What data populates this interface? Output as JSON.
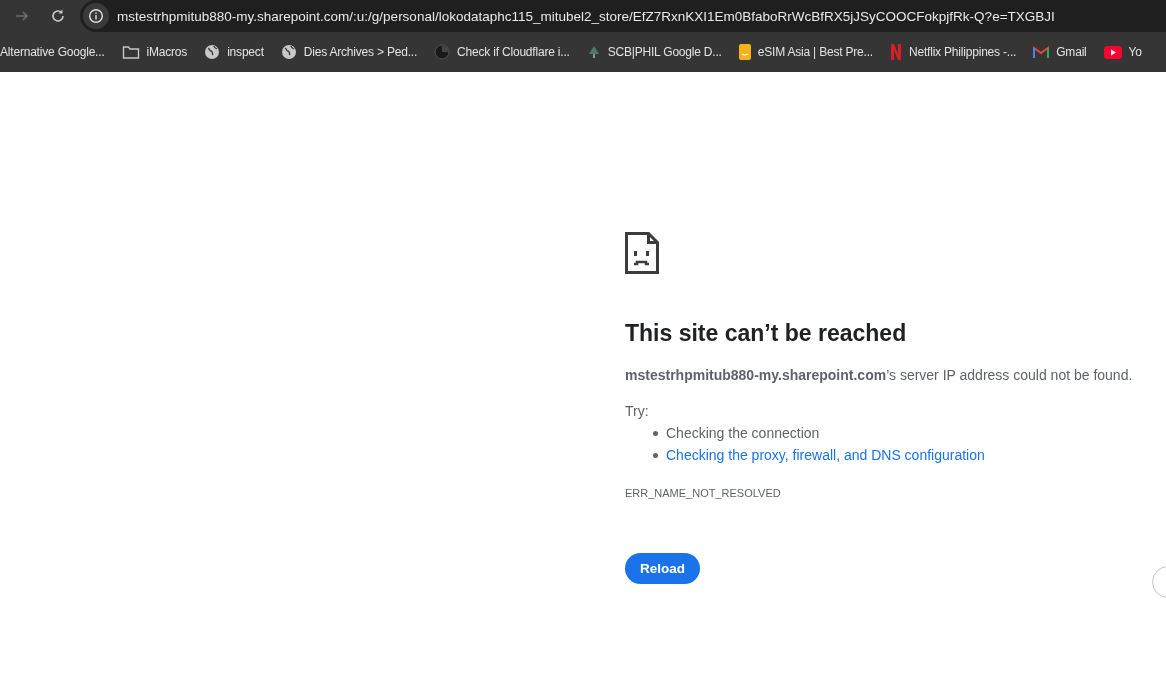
{
  "toolbar": {
    "url": "mstestrhpmitub880-my.sharepoint.com/:u:/g/personal/lokodataphc115_mitubel2_store/EfZ7RxnKXI1Em0BfaboRrWcBfRX5jJSyCOOCFokpjfRk-Q?e=TXGBJI"
  },
  "bookmarks": [
    {
      "label": "Alternative Google...",
      "kind": "none"
    },
    {
      "label": "iMacros",
      "kind": "folder"
    },
    {
      "label": "inspect",
      "kind": "globe"
    },
    {
      "label": "Dies Archives > Ped...",
      "kind": "globe"
    },
    {
      "label": "Check if Cloudflare i...",
      "kind": "dark"
    },
    {
      "label": "SCB|PHIL Google D...",
      "kind": "scb"
    },
    {
      "label": "eSIM Asia | Best Pre...",
      "kind": "esim"
    },
    {
      "label": "Netflix Philippines -...",
      "kind": "netflix"
    },
    {
      "label": "Gmail",
      "kind": "gmail"
    },
    {
      "label": "Yo",
      "kind": "youtube"
    }
  ],
  "error": {
    "title": "This site can’t be reached",
    "host": "mstestrhpmitub880-my.sharepoint.com",
    "message": "’s server IP address could not be found.",
    "try_label": "Try:",
    "suggestions": [
      {
        "text": "Checking the connection",
        "kind": "text"
      },
      {
        "text": "Checking the proxy, firewall, and DNS configuration",
        "kind": "link"
      }
    ],
    "code": "ERR_NAME_NOT_RESOLVED",
    "button": "Reload"
  }
}
